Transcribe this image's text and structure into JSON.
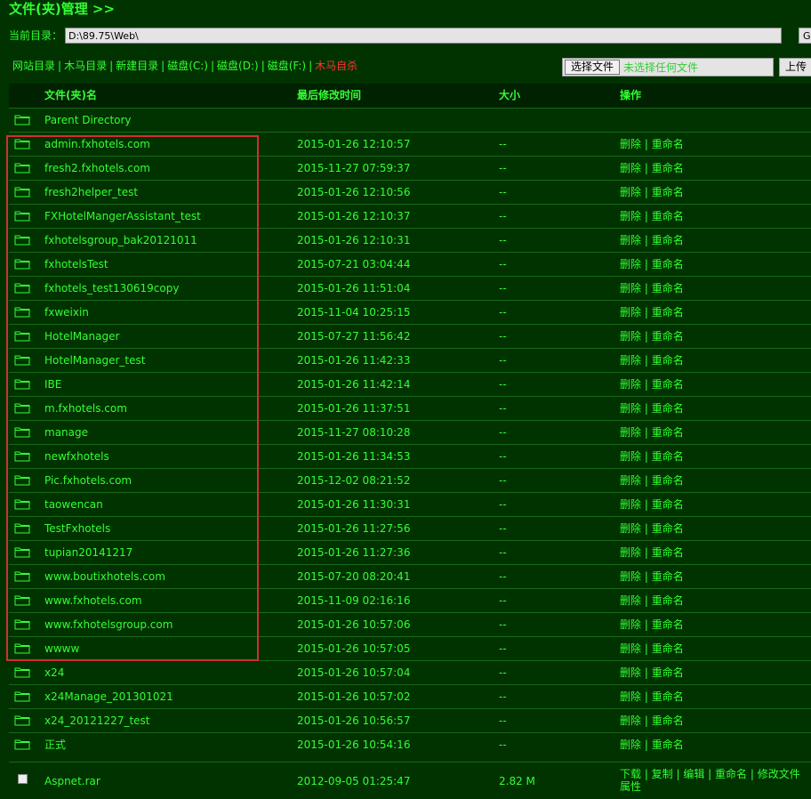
{
  "page": {
    "title": "文件(夹)管理 >>"
  },
  "pathbar": {
    "label": "当前目录：",
    "path": "D:\\89.75\\Web\\",
    "go": "Go"
  },
  "nav": {
    "items": [
      "网站目录",
      "木马目录",
      "新建目录",
      "磁盘(C:)",
      "磁盘(D:)",
      "磁盘(F:)"
    ],
    "danger": "木马自杀"
  },
  "upload": {
    "choose": "选择文件",
    "status": "未选择任何文件",
    "button": "上传"
  },
  "headers": {
    "name": "文件(夹)名",
    "modified": "最后修改时间",
    "size": "大小",
    "action": "操作"
  },
  "parent": "Parent Directory",
  "ops": {
    "delete": "删除",
    "sep": "|",
    "rename": "重命名"
  },
  "folders": [
    {
      "name": "admin.fxhotels.com",
      "time": "2015-01-26 12:10:57",
      "size": "--"
    },
    {
      "name": "fresh2.fxhotels.com",
      "time": "2015-11-27 07:59:37",
      "size": "--"
    },
    {
      "name": "fresh2helper_test",
      "time": "2015-01-26 12:10:56",
      "size": "--"
    },
    {
      "name": "FXHotelMangerAssistant_test",
      "time": "2015-01-26 12:10:37",
      "size": "--"
    },
    {
      "name": "fxhotelsgroup_bak20121011",
      "time": "2015-01-26 12:10:31",
      "size": "--"
    },
    {
      "name": "fxhotelsTest",
      "time": "2015-07-21 03:04:44",
      "size": "--"
    },
    {
      "name": "fxhotels_test130619copy",
      "time": "2015-01-26 11:51:04",
      "size": "--"
    },
    {
      "name": "fxweixin",
      "time": "2015-11-04 10:25:15",
      "size": "--"
    },
    {
      "name": "HotelManager",
      "time": "2015-07-27 11:56:42",
      "size": "--"
    },
    {
      "name": "HotelManager_test",
      "time": "2015-01-26 11:42:33",
      "size": "--"
    },
    {
      "name": "IBE",
      "time": "2015-01-26 11:42:14",
      "size": "--"
    },
    {
      "name": "m.fxhotels.com",
      "time": "2015-01-26 11:37:51",
      "size": "--"
    },
    {
      "name": "manage",
      "time": "2015-11-27 08:10:28",
      "size": "--"
    },
    {
      "name": "newfxhotels",
      "time": "2015-01-26 11:34:53",
      "size": "--"
    },
    {
      "name": "Pic.fxhotels.com",
      "time": "2015-12-02 08:21:52",
      "size": "--"
    },
    {
      "name": "taowencan",
      "time": "2015-01-26 11:30:31",
      "size": "--"
    },
    {
      "name": "TestFxhotels",
      "time": "2015-01-26 11:27:56",
      "size": "--"
    },
    {
      "name": "tupian20141217",
      "time": "2015-01-26 11:27:36",
      "size": "--"
    },
    {
      "name": "www.boutixhotels.com",
      "time": "2015-07-20 08:20:41",
      "size": "--"
    },
    {
      "name": "www.fxhotels.com",
      "time": "2015-11-09 02:16:16",
      "size": "--"
    },
    {
      "name": "www.fxhotelsgroup.com",
      "time": "2015-01-26 10:57:06",
      "size": "--"
    },
    {
      "name": "wwww",
      "time": "2015-01-26 10:57:05",
      "size": "--"
    },
    {
      "name": "x24",
      "time": "2015-01-26 10:57:04",
      "size": "--"
    },
    {
      "name": "x24Manage_201301021",
      "time": "2015-01-26 10:57:02",
      "size": "--"
    },
    {
      "name": "x24_20121227_test",
      "time": "2015-01-26 10:56:57",
      "size": "--"
    },
    {
      "name": "正式",
      "time": "2015-01-26 10:54:16",
      "size": "--"
    }
  ],
  "file": {
    "name": "Aspnet.rar",
    "time": "2012-09-05 01:25:47",
    "size": "2.82 M",
    "ops_line1": "下载 | 复制 | 编辑 | 重命名 | 修改文件",
    "ops_line2": "属性"
  },
  "colors": {
    "background": "#003300",
    "text": "#33ff33",
    "danger": "#ff3333",
    "highlight": "#d03030"
  }
}
